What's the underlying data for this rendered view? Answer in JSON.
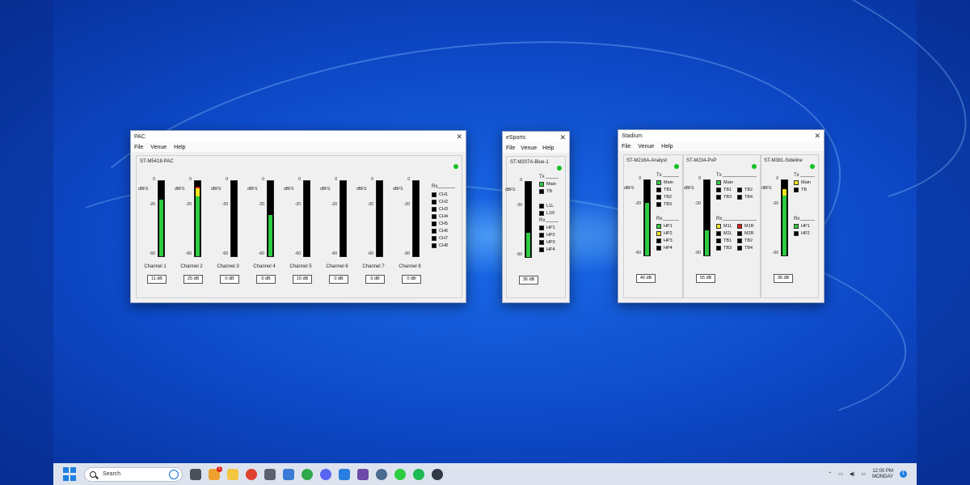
{
  "pac": {
    "title": "PAC",
    "menu": [
      "File",
      "Venue",
      "Help"
    ],
    "device": "ST-M5418-PAC",
    "ticks": [
      "0",
      "-20",
      "-60"
    ],
    "dbfs": "dBFS",
    "channels": [
      {
        "label": "Channel 1",
        "gain": "11 dB",
        "level": 0.75,
        "peak": "green"
      },
      {
        "label": "Channel 2",
        "gain": "25 dB",
        "level": 0.93,
        "peak": "red"
      },
      {
        "label": "Channel 3",
        "gain": "0 dB",
        "level": 0,
        "peak": "none"
      },
      {
        "label": "Channel 4",
        "gain": "0 dB",
        "level": 0.55,
        "peak": "green"
      },
      {
        "label": "Channel 5",
        "gain": "15 dB",
        "level": 0,
        "peak": "none"
      },
      {
        "label": "Channel 6",
        "gain": "0 dB",
        "level": 0,
        "peak": "none"
      },
      {
        "label": "Channel 7",
        "gain": "0 dB",
        "level": 0,
        "peak": "none"
      },
      {
        "label": "Channel 8",
        "gain": "0 dB",
        "level": 0,
        "peak": "none"
      }
    ],
    "rx_label": "Rx",
    "rx": [
      "CH1",
      "CH2",
      "CH3",
      "CH4",
      "CH5",
      "CH6",
      "CH7",
      "CH8"
    ]
  },
  "esports": {
    "title": "eSports",
    "menu": [
      "File",
      "Venue",
      "Help"
    ],
    "device": "ST-M207A-Blue-1",
    "gain": "36 dB",
    "level": 0.32,
    "tx_label": "Tx",
    "tx": [
      {
        "label": "Main",
        "color": "green"
      },
      {
        "label": "TB",
        "color": "black"
      }
    ],
    "tx2": [
      {
        "label": "L1L",
        "color": "black"
      },
      {
        "label": "L1R",
        "color": "black"
      }
    ],
    "rx_label": "Rx",
    "rx": [
      {
        "label": "HP1",
        "color": "black"
      },
      {
        "label": "HP2",
        "color": "black"
      },
      {
        "label": "HP3",
        "color": "black"
      },
      {
        "label": "HP4",
        "color": "black"
      }
    ]
  },
  "stadium": {
    "title": "Stadium",
    "menu": [
      "File",
      "Venue",
      "Help"
    ],
    "devices": [
      {
        "name": "ST-M216A-Analyst",
        "gain": "40 dB",
        "level": 0.7,
        "peak": "green",
        "tx_label": "Tx",
        "tx": [
          {
            "label": "Main",
            "color": "green"
          },
          {
            "label": "TB1",
            "color": "black"
          },
          {
            "label": "TB2",
            "color": "black"
          },
          {
            "label": "TB3",
            "color": "black"
          }
        ],
        "rx_label": "Rx",
        "rx": [
          {
            "label": "HP1",
            "color": "green"
          },
          {
            "label": "HP2",
            "color": "yellow"
          },
          {
            "label": "HP3",
            "color": "black"
          },
          {
            "label": "HP4",
            "color": "black"
          }
        ]
      },
      {
        "name": "ST-M234-PxP",
        "gain": "55 dB",
        "level": 0.33,
        "peak": "green",
        "tx_label": "Tx",
        "tx": [
          {
            "label": "Main",
            "color": "green"
          },
          {
            "label": "TB1",
            "color": "black"
          },
          {
            "label": "TB2",
            "color": "black"
          },
          {
            "label": "TB3",
            "color": "black"
          },
          {
            "label": "TB4",
            "color": "black"
          }
        ],
        "rx_label": "Rx",
        "rx": [
          {
            "label": "M1L",
            "color": "yellow"
          },
          {
            "label": "M1R",
            "color": "red"
          },
          {
            "label": "M2L",
            "color": "black"
          },
          {
            "label": "M2R",
            "color": "black"
          },
          {
            "label": "TB1",
            "color": "black"
          },
          {
            "label": "TB2",
            "color": "black"
          },
          {
            "label": "TB3",
            "color": "black"
          },
          {
            "label": "TB4",
            "color": "black"
          }
        ]
      },
      {
        "name": "ST-M381-Sideline",
        "gain": "36 dB",
        "level": 0.88,
        "peak": "yellow",
        "tx_label": "Tx",
        "tx": [
          {
            "label": "Main",
            "color": "yellow"
          },
          {
            "label": "TB",
            "color": "black"
          }
        ],
        "rx_label": "Rx",
        "rx": [
          {
            "label": "HP1",
            "color": "green"
          },
          {
            "label": "HP2",
            "color": "black"
          }
        ]
      }
    ]
  },
  "taskbar": {
    "search_placeholder": "Search",
    "clock_time": "12:00 PM",
    "clock_day": "MONDAY",
    "notification_count": "1",
    "badge_count": "1"
  }
}
